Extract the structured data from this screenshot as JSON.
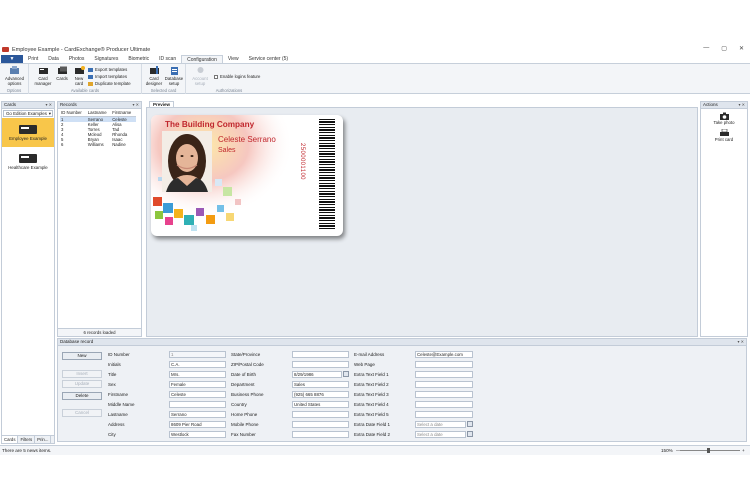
{
  "window": {
    "title": "Employee Example - CardExchange® Producer Ultimate",
    "controls": [
      "—",
      "▢",
      "✕"
    ]
  },
  "ribbon": {
    "file_label": "▼",
    "tabs": [
      "Print",
      "Data",
      "Photos",
      "Signatures",
      "Biometric",
      "ID scan",
      "Configuration",
      "View",
      "Service center (5)"
    ],
    "active_tab": "Configuration",
    "groups": {
      "options": {
        "label": "Options",
        "advanced": "Advanced options"
      },
      "available": {
        "label": "Available cards",
        "card_manager": "Card manager",
        "cards": "Cards",
        "new_card": "New card",
        "export": "Export templates",
        "import": "Import templates",
        "duplicate": "Duplicate template"
      },
      "selected": {
        "label": "Selected card",
        "designer": "Card designer",
        "database": "Database setup"
      },
      "auth": {
        "label": "Authorizations",
        "account": "Account setup",
        "logins": "Enable logins feature"
      }
    }
  },
  "cards_panel": {
    "title": "Cards",
    "dropdown": "Go Edition Examples",
    "items": [
      "Employee Example",
      "Healthcare Example"
    ],
    "bottom_tabs": [
      "Cards",
      "Filters",
      "Prin..."
    ]
  },
  "records_panel": {
    "title": "Records",
    "columns": [
      "ID Number",
      "Lastname",
      "Firstname"
    ],
    "rows": [
      [
        "1",
        "Serrano",
        "Celeste"
      ],
      [
        "2",
        "Keller",
        "Alisa"
      ],
      [
        "3",
        "Torres",
        "Tad"
      ],
      [
        "4",
        "Mcleod",
        "Rhonda"
      ],
      [
        "5",
        "Bryan",
        "Isaac"
      ],
      [
        "6",
        "Williams",
        "Nadine"
      ]
    ],
    "status": "6 records loaded"
  },
  "preview": {
    "tab_label": "Preview",
    "card": {
      "company": "The Building Company",
      "name": "Celeste Serrano",
      "department": "Sales",
      "id_number": "2500001100"
    }
  },
  "actions_panel": {
    "title": "Actions",
    "take_photo": "Take photo",
    "print_card": "Print card"
  },
  "db_record": {
    "title": "Database record",
    "buttons": [
      "New",
      "Insert",
      "Update",
      "Delete",
      "Cancel"
    ],
    "col1": [
      {
        "label": "ID Number",
        "value": "1"
      },
      {
        "label": "Initials",
        "value": "C.A."
      },
      {
        "label": "Title",
        "value": "Mrs."
      },
      {
        "label": "Sex",
        "value": "Female"
      },
      {
        "label": "Firstname",
        "value": "Celeste"
      },
      {
        "label": "Middle Name",
        "value": ""
      },
      {
        "label": "Lastname",
        "value": "Serrano"
      },
      {
        "label": "Address",
        "value": "8609 Pier Road"
      },
      {
        "label": "City",
        "value": "Westlock"
      }
    ],
    "col2": [
      {
        "label": "State/Province",
        "value": ""
      },
      {
        "label": "ZIP/Postal Code",
        "value": ""
      },
      {
        "label": "Date of Birth",
        "value": "8/29/1986"
      },
      {
        "label": "Department",
        "value": "Sales"
      },
      {
        "label": "Business Phone",
        "value": "(925) 665 8876"
      },
      {
        "label": "Country",
        "value": "United States"
      },
      {
        "label": "Home Phone",
        "value": ""
      },
      {
        "label": "Mobile Phone",
        "value": ""
      },
      {
        "label": "Fax Number",
        "value": ""
      }
    ],
    "col3": [
      {
        "label": "E-mail Address",
        "value": "Celeste@Example.com"
      },
      {
        "label": "Web Page",
        "value": ""
      },
      {
        "label": "Extra Text Field 1",
        "value": ""
      },
      {
        "label": "Extra Text Field 2",
        "value": ""
      },
      {
        "label": "Extra Text Field 3",
        "value": ""
      },
      {
        "label": "Extra Text Field 4",
        "value": ""
      },
      {
        "label": "Extra Text Field 5",
        "value": ""
      },
      {
        "label": "Extra Date Field 1",
        "value": "Select a date"
      },
      {
        "label": "Extra Date Field 2",
        "value": "Select a date"
      }
    ]
  },
  "status_bar": {
    "message": "There are 5 news items.",
    "zoom": "150%",
    "zoom_minus": "—",
    "zoom_plus": "+"
  },
  "colors": {
    "accent": "#2b579a",
    "brand_red": "#c0272d",
    "selected_card": "#f8c64a"
  }
}
